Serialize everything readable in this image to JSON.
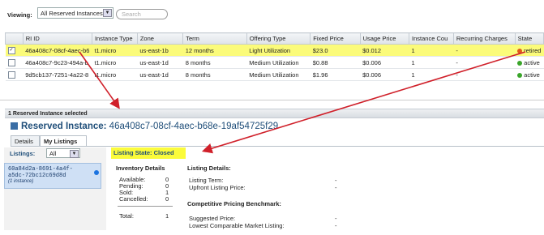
{
  "filter": {
    "viewing_label": "Viewing:",
    "selected": "All Reserved Instances",
    "search_placeholder": "Search"
  },
  "table": {
    "columns": [
      "RI ID",
      "Instance Type",
      "Zone",
      "Term",
      "Offering Type",
      "Fixed Price",
      "Usage Price",
      "Instance Cou",
      "Recurring Charges",
      "State"
    ],
    "rows": [
      {
        "checked": true,
        "id": "46a408c7-08cf-4aec-b6",
        "type": "t1.micro",
        "zone": "us-east-1b",
        "term": "12 months",
        "offering": "Light Utilization",
        "fixed": "$23.0",
        "usage": "$0.012",
        "count": "1",
        "recurring": "-",
        "state": "retired",
        "state_color": "#e05a1a"
      },
      {
        "checked": false,
        "id": "46a408c7-9c23-494a-b",
        "type": "t1.micro",
        "zone": "us-east-1d",
        "term": "8 months",
        "offering": "Medium Utilization",
        "fixed": "$0.88",
        "usage": "$0.006",
        "count": "1",
        "recurring": "-",
        "state": "active",
        "state_color": "#3aa52a"
      },
      {
        "checked": false,
        "id": "9d5cb137-7251-4a22-8",
        "type": "t1.micro",
        "zone": "us-east-1d",
        "term": "8 months",
        "offering": "Medium Utilization",
        "fixed": "$1.96",
        "usage": "$0.006",
        "count": "1",
        "recurring": "-",
        "state": "active",
        "state_color": "#3aa52a"
      }
    ]
  },
  "selected_bar": "1 Reserved Instance selected",
  "ri": {
    "label": "Reserved Instance:",
    "id": "46a408c7-08cf-4aec-b68e-19af54725f29"
  },
  "tabs": [
    "Details",
    "My Listings"
  ],
  "listings": {
    "label": "Listings:",
    "selected": "All",
    "item_id_line1": "60a84d2a-8691-4a4f-",
    "item_id_line2": "a5dc-72bc12c69d8d",
    "item_sub": "(1 instance)"
  },
  "listing_state": "Listing State: Closed",
  "inventory": {
    "title": "Inventory Details",
    "rows": [
      {
        "label": "Available:",
        "value": "0"
      },
      {
        "label": "Pending:",
        "value": "0"
      },
      {
        "label": "Sold:",
        "value": "1"
      },
      {
        "label": "Cancelled:",
        "value": "0"
      }
    ],
    "total_label": "Total:",
    "total_value": "1"
  },
  "details": {
    "title": "Listing Details:",
    "term_label": "Listing Term:",
    "term_value": "-",
    "upfront_label": "Upfront Listing Price:",
    "upfront_value": "-",
    "bench_title": "Competitive Pricing Benchmark:",
    "suggested_label": "Suggested Price:",
    "suggested_value": "-",
    "lowest_label": "Lowest Comparable Market Listing:",
    "lowest_value": "-"
  },
  "colors": {
    "highlight": "#fbfb7a",
    "state_highlight": "#fbfb3a",
    "title_blue": "#1f4e79",
    "arrow_red": "#d0202a"
  }
}
